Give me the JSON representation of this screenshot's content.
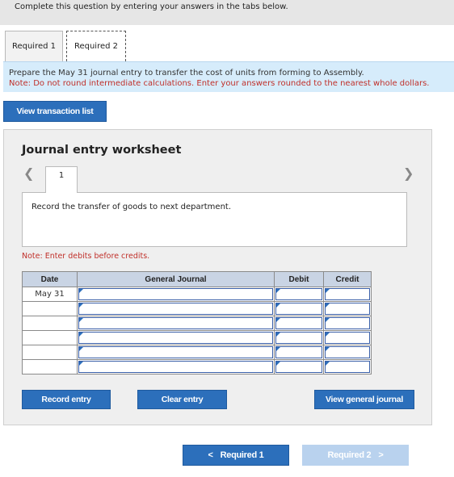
{
  "banner": {
    "text": "Complete this question by entering your answers in the tabs below."
  },
  "tabs": [
    {
      "label": "Required 1",
      "active": false
    },
    {
      "label": "Required 2",
      "active": true
    }
  ],
  "instructions": {
    "prompt": "Prepare the May 31 journal entry to transfer the cost of units from forming to Assembly.",
    "note": "Note: Do not round intermediate calculations. Enter your answers rounded to the nearest whole dollars."
  },
  "view_transaction_label": "View transaction list",
  "worksheet": {
    "title": "Journal entry worksheet",
    "nav_prev_icon": "chevron-left-icon",
    "nav_next_icon": "chevron-right-icon",
    "current_entry": "1",
    "entry_description": "Record the transfer of goods to next department.",
    "note": "Note: Enter debits before credits.",
    "columns": {
      "date": "Date",
      "general_journal": "General Journal",
      "debit": "Debit",
      "credit": "Credit"
    },
    "rows": [
      {
        "date": "May 31",
        "account": "",
        "debit": "",
        "credit": ""
      },
      {
        "date": "",
        "account": "",
        "debit": "",
        "credit": ""
      },
      {
        "date": "",
        "account": "",
        "debit": "",
        "credit": ""
      },
      {
        "date": "",
        "account": "",
        "debit": "",
        "credit": ""
      },
      {
        "date": "",
        "account": "",
        "debit": "",
        "credit": ""
      },
      {
        "date": "",
        "account": "",
        "debit": "",
        "credit": ""
      }
    ],
    "record_entry_label": "Record entry",
    "clear_entry_label": "Clear entry",
    "view_general_journal_label": "View general journal"
  },
  "bottom_nav": {
    "prev_label": "Required 1",
    "next_label": "Required 2",
    "prev_arrow": "<",
    "next_arrow": ">"
  },
  "colors": {
    "accent_blue": "#2c6fbb",
    "disabled_blue": "#b9d2ee",
    "note_red": "#c0302a",
    "instructions_bg": "#d6ecfb",
    "table_header_bg": "#c9d4e4"
  }
}
